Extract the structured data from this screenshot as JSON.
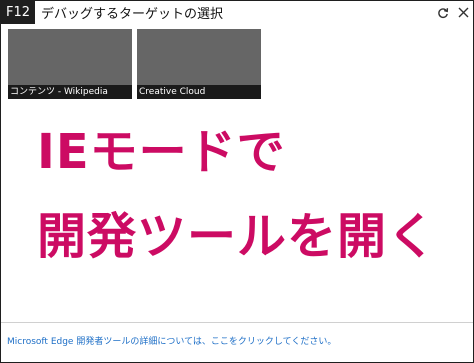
{
  "titlebar": {
    "f12_label": "F12",
    "title": "デバッグするターゲットの選択"
  },
  "tiles": [
    {
      "caption": "コンテンツ - Wikipedia"
    },
    {
      "caption": "Creative Cloud"
    }
  ],
  "overlay": {
    "line1": "IEモードで",
    "line2": "開発ツールを開く",
    "color": "#cc0b63"
  },
  "footer": {
    "prefix": "Microsoft Edge",
    "link": "開発者ツールの詳細については、ここをクリックしてください。"
  },
  "icons": {
    "refresh": "refresh-icon",
    "close": "close-icon"
  }
}
